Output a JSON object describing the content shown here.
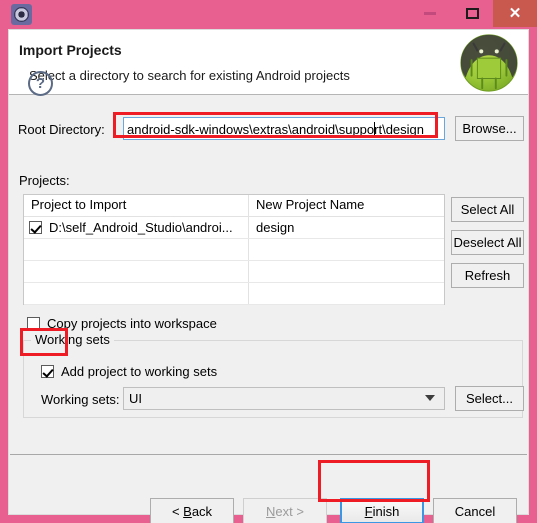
{
  "window": {
    "icon": "gear-icon",
    "controls": {
      "minimize": "–",
      "maximize": "☐",
      "close": "✕"
    }
  },
  "header": {
    "title": "Import Projects",
    "subtitle": "Select a directory to search for existing Android projects",
    "logo": "android-logo"
  },
  "form": {
    "root_directory_label": "Root Directory:",
    "root_directory_value_before_caret": "android-sdk-windows\\extras\\android\\suppo",
    "root_directory_value_after_caret": "rt\\design",
    "root_directory_full": "android-sdk-windows\\extras\\android\\support\\design",
    "browse_label": "Browse...",
    "projects_label": "Projects:"
  },
  "table": {
    "columns": [
      "Project to Import",
      "New Project Name"
    ],
    "rows": [
      {
        "checked": true,
        "project": "D:\\self_Android_Studio\\androi...",
        "new_name": "design"
      },
      {
        "checked": null,
        "project": "",
        "new_name": ""
      },
      {
        "checked": null,
        "project": "",
        "new_name": ""
      },
      {
        "checked": null,
        "project": "",
        "new_name": ""
      }
    ],
    "buttons": {
      "select_all": "Select All",
      "deselect_all": "Deselect All",
      "refresh": "Refresh"
    }
  },
  "options": {
    "copy_projects_label": "Copy projects into workspace",
    "copy_projects_checked": false
  },
  "working_sets": {
    "group_label": "Working sets",
    "add_project_label": "Add project to working sets",
    "add_project_checked": true,
    "working_sets_label": "Working sets:",
    "working_sets_value": "UI",
    "select_label": "Select..."
  },
  "footer": {
    "help": "?",
    "back_label": "< Back",
    "next_label": "Next >",
    "finish_label": "Finish",
    "cancel_label": "Cancel"
  },
  "colors": {
    "frame": "#e8608f",
    "close_button": "#c9584f",
    "annotation": "#ee1c25",
    "focus": "#3b97e3"
  }
}
